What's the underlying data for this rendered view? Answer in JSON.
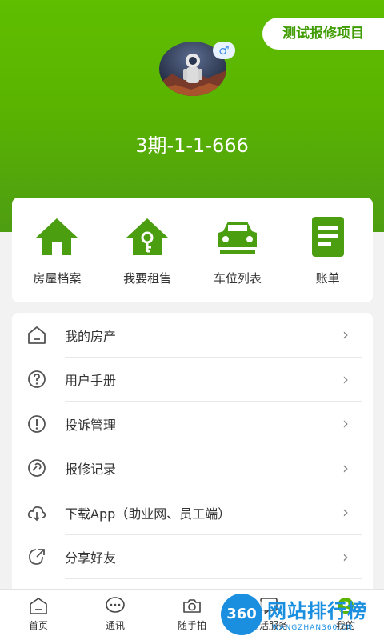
{
  "header": {
    "project_chip": "测试报修项目",
    "gender_symbol": "♂",
    "room_id": "3期-1-1-666"
  },
  "quick_actions": [
    {
      "label": "房屋档案",
      "icon": "house-icon"
    },
    {
      "label": "我要租售",
      "icon": "house-key-icon"
    },
    {
      "label": "车位列表",
      "icon": "car-icon"
    },
    {
      "label": "账单",
      "icon": "bill-icon"
    }
  ],
  "menu": [
    {
      "label": "我的房产",
      "icon": "home-outline-icon"
    },
    {
      "label": "用户手册",
      "icon": "help-circle-icon"
    },
    {
      "label": "投诉管理",
      "icon": "alert-circle-icon"
    },
    {
      "label": "报修记录",
      "icon": "wrench-circle-icon"
    },
    {
      "label": "下载App（助业网、员工端）",
      "icon": "cloud-download-icon"
    },
    {
      "label": "分享好友",
      "icon": "share-icon"
    }
  ],
  "chevron": "›",
  "tabbar": [
    {
      "label": "首页",
      "icon": "home-tab-icon"
    },
    {
      "label": "通讯",
      "icon": "chat-tab-icon"
    },
    {
      "label": "随手拍",
      "icon": "camera-tab-icon"
    },
    {
      "label": "生活服务",
      "icon": "message-tab-icon"
    },
    {
      "label": "我的",
      "icon": "profile-tab-icon"
    }
  ],
  "watermark": {
    "badge": "360",
    "text": "网站排行榜",
    "url": "WANGZHAN360.CN"
  },
  "colors": {
    "brand_green": "#5ab400",
    "icon_green": "#4a9e10",
    "watermark_blue": "#1a8fe0"
  }
}
